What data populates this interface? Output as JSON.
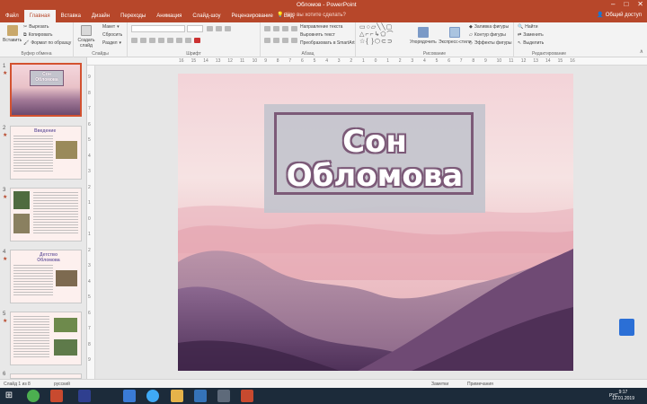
{
  "window": {
    "title": "Обломов - PowerPoint",
    "tell_me": "Что вы хотите сделать?",
    "share": "Общий доступ",
    "controls": [
      "–",
      "□",
      "✕"
    ]
  },
  "tabs": [
    "Файл",
    "Главная",
    "Вставка",
    "Дизайн",
    "Переходы",
    "Анимация",
    "Слайд-шоу",
    "Рецензирование",
    "Вид"
  ],
  "active_tab": "Главная",
  "ribbon": {
    "clipboard": {
      "paste": "Вставить",
      "cut": "Вырезать",
      "copy": "Копировать",
      "format": "Формат по образцу",
      "label": "Буфер обмена"
    },
    "slides": {
      "new": "Создать слайд",
      "layout": "Макет",
      "reset": "Сбросить",
      "section": "Раздел",
      "label": "Слайды"
    },
    "font": {
      "label": "Шрифт"
    },
    "paragraph": {
      "direction": "Направление текста",
      "align": "Выровнять текст",
      "smartart": "Преобразовать в SmartArt",
      "label": "Абзац"
    },
    "drawing": {
      "arrange": "Упорядочить",
      "styles": "Экспресс-стили",
      "fill": "Заливка фигуры",
      "outline": "Контур фигуры",
      "effects": "Эффекты фигуры",
      "label": "Рисование"
    },
    "editing": {
      "find": "Найти",
      "replace": "Заменить",
      "select": "Выделить",
      "label": "Редактирование"
    }
  },
  "slides": [
    {
      "num": "1",
      "title": "Сон Обломова"
    },
    {
      "num": "2",
      "title": "Введение"
    },
    {
      "num": "3",
      "title": ""
    },
    {
      "num": "4",
      "title": "Детство Обломова"
    },
    {
      "num": "5",
      "title": ""
    },
    {
      "num": "6",
      "title": ""
    }
  ],
  "main_slide": {
    "title_line1": "Сон",
    "title_line2": "Обломова"
  },
  "status": {
    "slide": "Слайд 1 из 8",
    "lang": "русский",
    "notes": "Заметки",
    "comments": "Примечания"
  },
  "taskbar": {
    "lang": "РУС",
    "time": "9:17",
    "date": "12.01.2019"
  },
  "colors": {
    "accent": "#b7472a",
    "title_frame": "#7c5a78",
    "slide_bg": "#f4d9da"
  }
}
